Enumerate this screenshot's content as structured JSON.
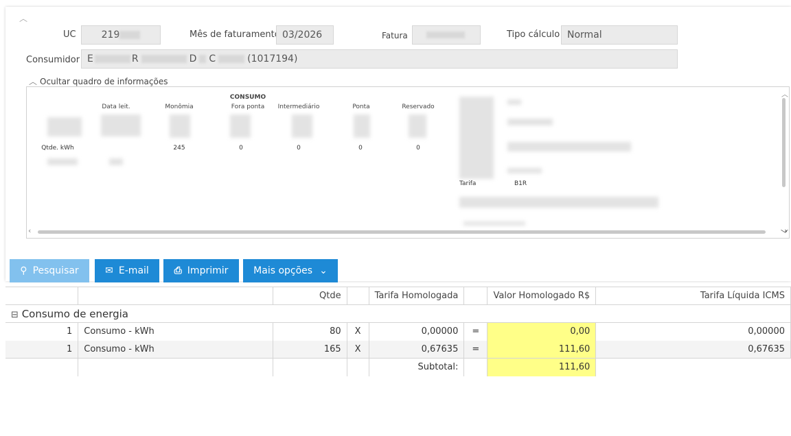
{
  "header": {
    "uc_label": "UC",
    "uc_value": "219",
    "mes_label": "Mês de faturamento",
    "mes_value": "03/2026",
    "fatura_label": "Fatura",
    "tipo_label": "Tipo cálculo",
    "tipo_value": "Normal",
    "consumidor_label": "Consumidor",
    "consumidor_parts": [
      "E",
      "R",
      "D",
      "C",
      "(1017194)"
    ]
  },
  "info_toggle": "Ocultar quadro de informações",
  "info_box": {
    "consumo_heading": "CONSUMO",
    "columns": [
      "Data leit.",
      "Monômia",
      "Fora ponta",
      "Intermediário",
      "Ponta",
      "Reservado"
    ],
    "qtde_label": "Qtde. kWh",
    "qtde_values": [
      "245",
      "0",
      "0",
      "0",
      "0"
    ],
    "tarifa_label": "Tarifa",
    "tarifa_value": "B1R"
  },
  "toolbar": {
    "search": "Pesquisar",
    "email": "E-mail",
    "print": "Imprimir",
    "more": "Mais opções"
  },
  "table": {
    "headers": [
      "",
      "",
      "Qtde",
      "",
      "Tarifa Homologada",
      "",
      "Valor Homologado R$",
      "Tarifa Líquida ICMS"
    ],
    "group": "Consumo de energia",
    "rows": [
      {
        "n": "1",
        "desc": "Consumo - kWh",
        "qtde": "80",
        "x": "X",
        "tarifa": "0,00000",
        "eq": "=",
        "valor": "0,00",
        "liquida": "0,00000"
      },
      {
        "n": "1",
        "desc": "Consumo - kWh",
        "qtde": "165",
        "x": "X",
        "tarifa": "0,67635",
        "eq": "=",
        "valor": "111,60",
        "liquida": "0,67635"
      }
    ],
    "subtotal_label": "Subtotal:",
    "subtotal_value": "111,60"
  },
  "colors": {
    "primary": "#1e8ad6",
    "primary_disabled": "#82c1ee",
    "highlight": "#ffff88"
  },
  "icons": [
    "chevron-up-icon",
    "search-icon",
    "mail-icon",
    "printer-icon",
    "chevron-down-icon",
    "minus-square-icon"
  ]
}
